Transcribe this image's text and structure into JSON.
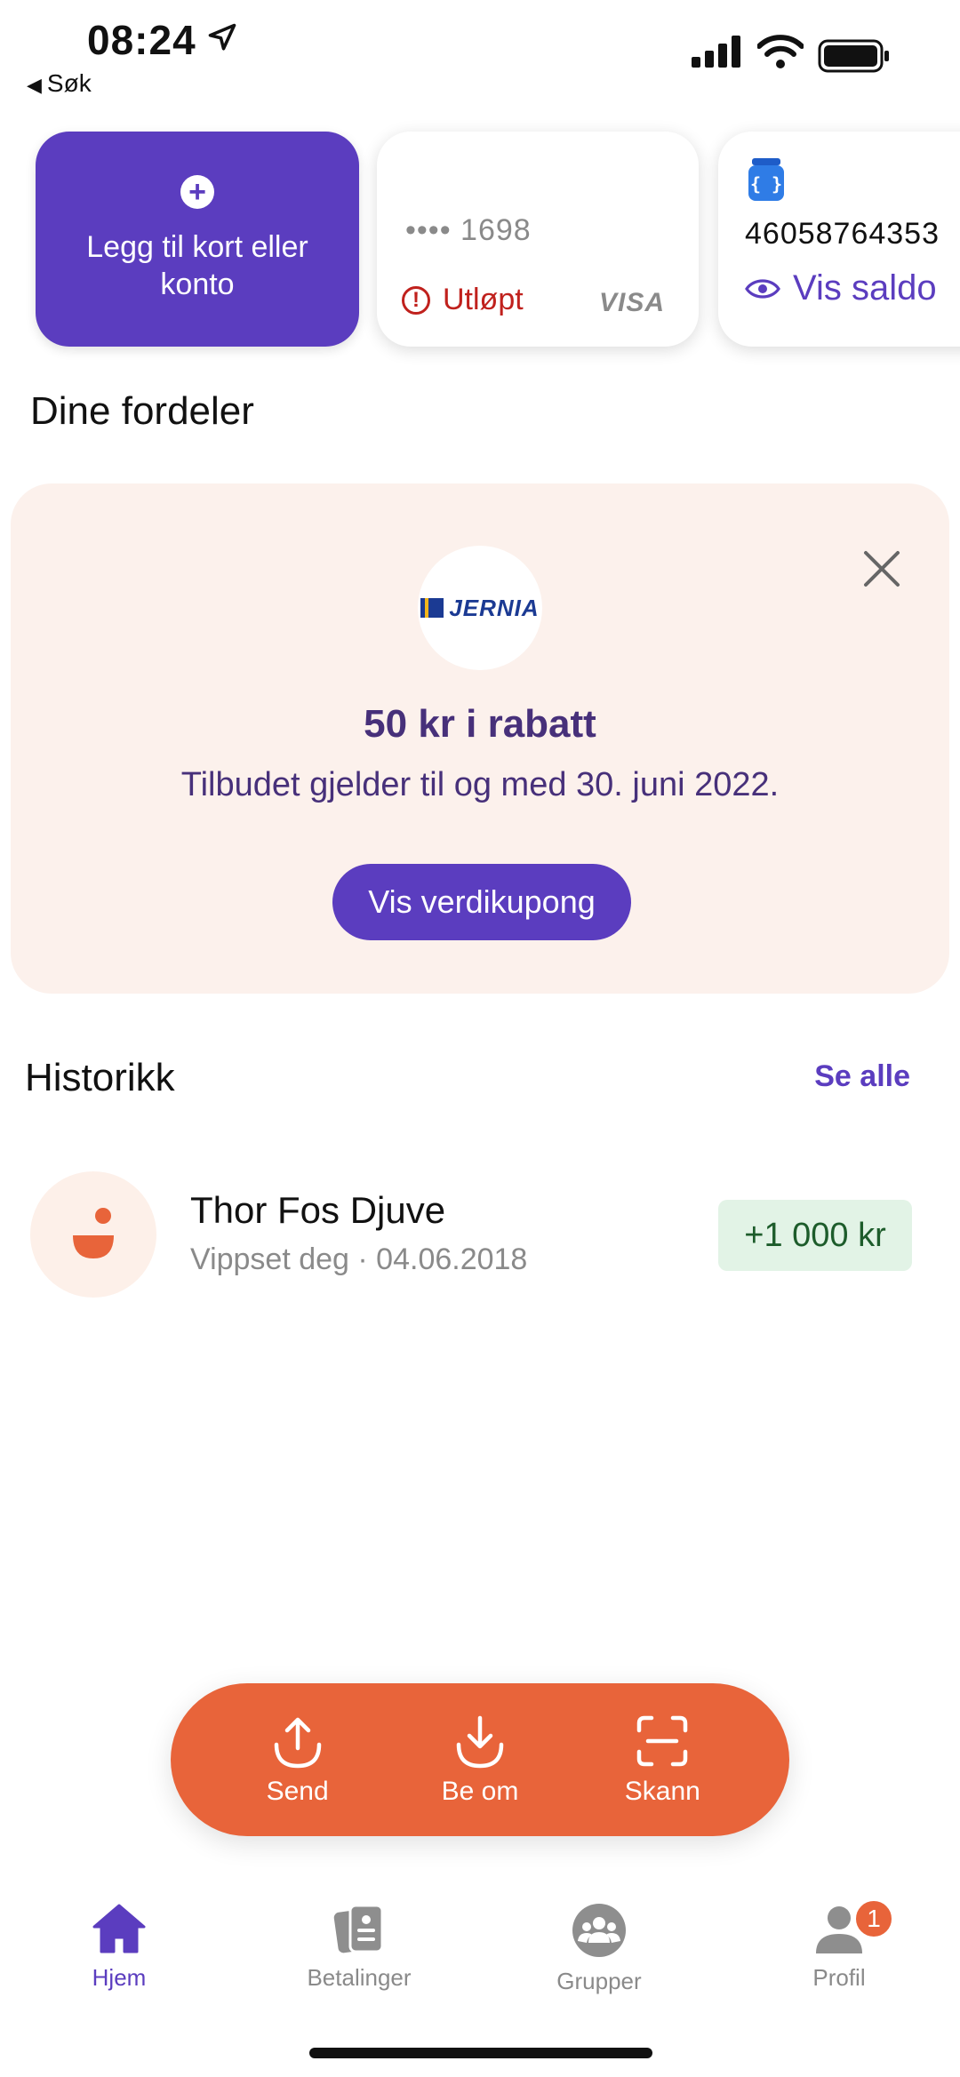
{
  "status_bar": {
    "time": "08:24",
    "back_label": "Søk"
  },
  "cards": {
    "add_label": "Legg til kort eller konto",
    "visa": {
      "masked_number": "•••• 1698",
      "status": "Utløpt",
      "brand": "VISA"
    },
    "account": {
      "number": "46058764353",
      "show_balance": "Vis saldo"
    }
  },
  "benefits": {
    "title": "Dine fordeler",
    "offer": {
      "logo_text": "JERNIA",
      "title": "50 kr i rabatt",
      "subtitle": "Tilbudet gjelder til og med 30. juni 2022.",
      "button": "Vis verdikupong"
    }
  },
  "history": {
    "title": "Historikk",
    "see_all": "Se alle",
    "items": [
      {
        "name": "Thor Fos Djuve",
        "meta": "Vippset deg · 04.06.2018",
        "amount": "+1 000 kr"
      }
    ]
  },
  "actions": {
    "send": "Send",
    "request": "Be om",
    "scan": "Skann"
  },
  "tabs": {
    "home": "Hjem",
    "payments": "Betalinger",
    "groups": "Grupper",
    "profile": "Profil",
    "profile_badge": "1"
  },
  "colors": {
    "brand": "#5b3dbf",
    "accent": "#e8643a",
    "error": "#c0211d",
    "positive": "#1d5c2b"
  }
}
